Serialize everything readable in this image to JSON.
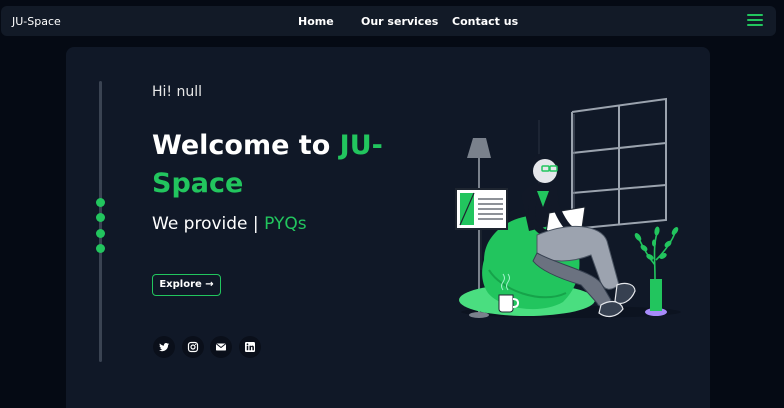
{
  "navbar": {
    "brand": "JU-Space",
    "links": [
      "Home",
      "Our services",
      "Contact us"
    ],
    "menu_icon": "hamburger-icon"
  },
  "hero": {
    "greeting": "Hi! null",
    "headline_white": "Welcome to ",
    "headline_green": "JU-Space",
    "tagline_prefix": "We provide | ",
    "tagline_highlight": "PYQs",
    "explore_label": "Explore →"
  },
  "social_icons": [
    "twitter-icon",
    "instagram-icon",
    "mail-icon",
    "linkedin-icon"
  ],
  "colors": {
    "accent": "#22c55e",
    "background": "#050a14",
    "card": "#101827",
    "navbar": "#121a27"
  }
}
